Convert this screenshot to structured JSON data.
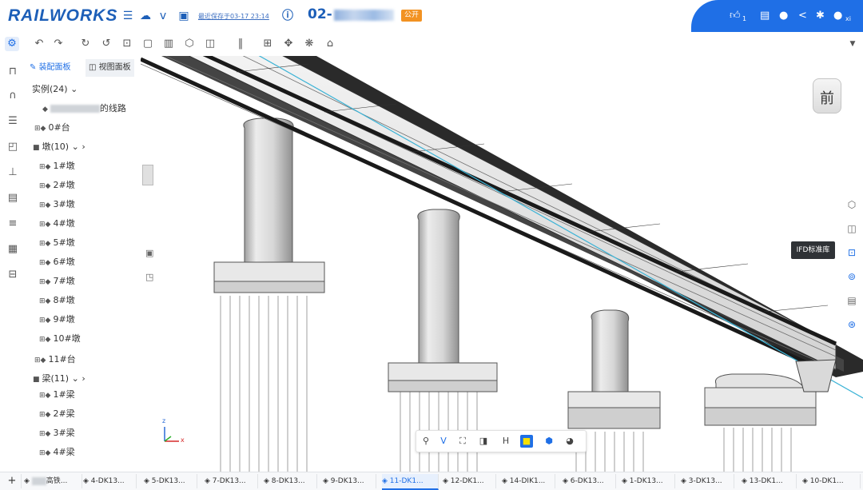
{
  "app": {
    "logo": "RAILWORKS",
    "save_text": "最近保存于03-17 23:14",
    "project": "02-",
    "badge": "公开"
  },
  "topbar_right": {
    "like_count": "1",
    "user_initials": "xi"
  },
  "left_panel": {
    "tabs": [
      {
        "label": "装配面板"
      },
      {
        "label": "视图面板"
      }
    ],
    "instances_header": "实例(24)",
    "line_item_suffix": "的线路",
    "abutment_start": "0#台",
    "piers_header": "墩(10)",
    "piers": [
      "1#墩",
      "2#墩",
      "3#墩",
      "4#墩",
      "5#墩",
      "6#墩",
      "7#墩",
      "8#墩",
      "9#墩",
      "10#墩"
    ],
    "abutment_end": "11#台",
    "beams_header": "梁(11)",
    "beams": [
      "1#梁",
      "2#梁",
      "3#梁",
      "4#梁"
    ]
  },
  "viewport": {
    "view_cube_label": "前",
    "tooltip": "IFD标准库",
    "axis_z": "z",
    "axis_x": "x"
  },
  "bottom_tabs": [
    "高铁...",
    "4-DK13...",
    "5-DK13...",
    "7-DK13...",
    "8-DK13...",
    "9-DK13...",
    "11-DK1...",
    "12-DK1...",
    "14-DIK1...",
    "6-DK13...",
    "1-DK13...",
    "3-DK13...",
    "13-DK1...",
    "10-DK1..."
  ],
  "active_tab_index": 6,
  "colors": {
    "brand": "#1d5fb8",
    "accent": "#1f6fe6",
    "badge": "#f29222",
    "tooltip_bg": "#2f3236"
  }
}
